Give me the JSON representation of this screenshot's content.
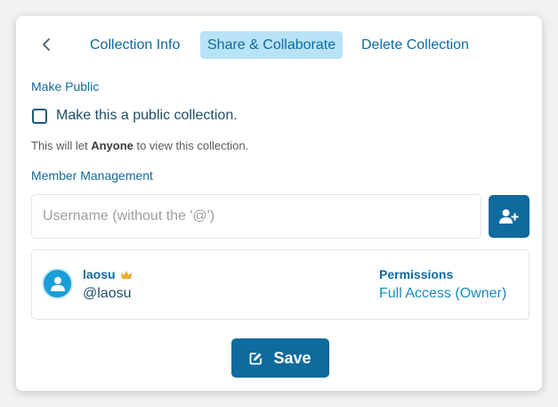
{
  "tabs": {
    "info": "Collection Info",
    "share": "Share & Collaborate",
    "delete": "Delete Collection",
    "active": "share"
  },
  "public_section": {
    "label": "Make Public",
    "checkbox_label": "Make this a public collection.",
    "checked": false,
    "hint_prefix": "This will let ",
    "hint_bold": "Anyone",
    "hint_suffix": " to view this collection."
  },
  "member_section": {
    "label": "Member Management",
    "input_placeholder": "Username (without the '@')",
    "input_value": ""
  },
  "members": [
    {
      "name": "laosu",
      "handle": "@laosu",
      "is_owner": true,
      "permissions_label": "Permissions",
      "permission": "Full Access (Owner)"
    }
  ],
  "save_label": "Save",
  "colors": {
    "accent": "#0f6a9e",
    "active_tab_bg": "#b8e3f7",
    "avatar": "#1a9ed8",
    "crown": "#f0a92b"
  }
}
